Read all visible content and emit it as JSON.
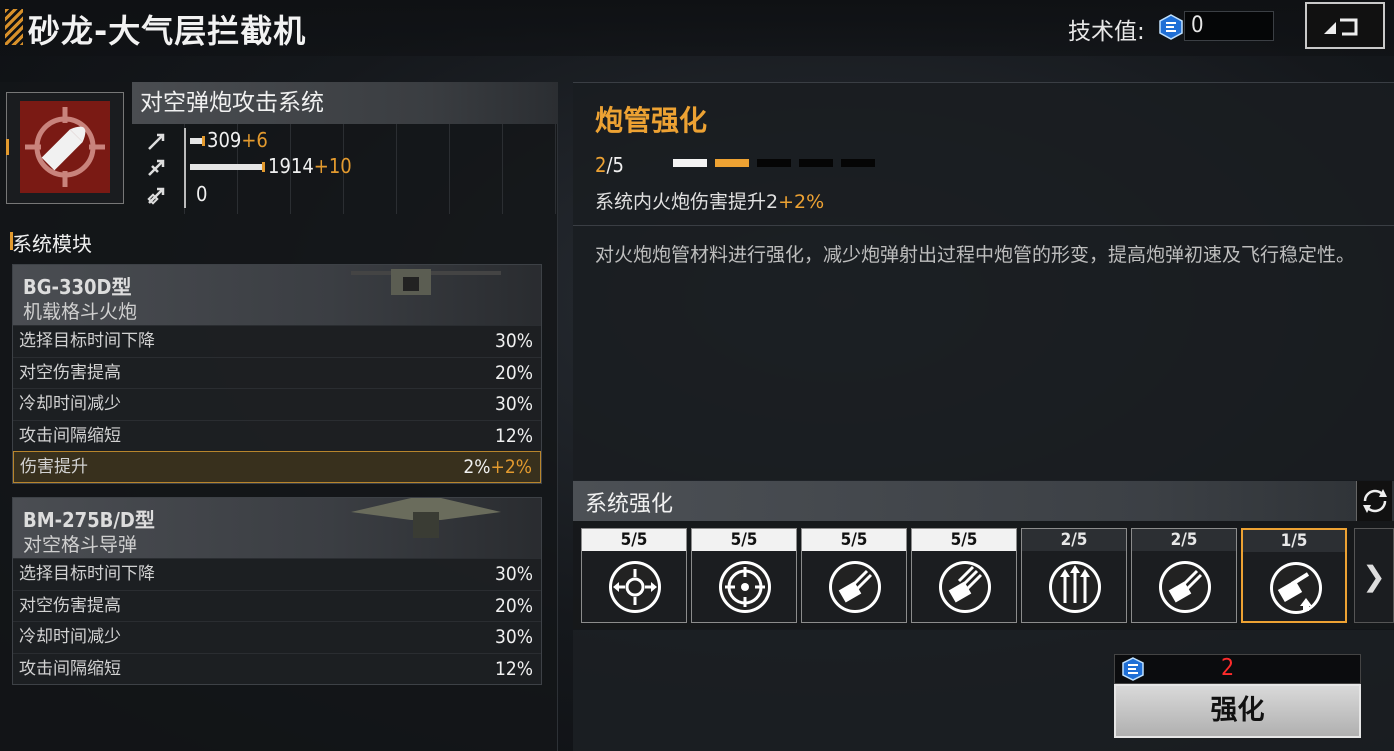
{
  "header": {
    "title": "砂龙-大气层拦截机",
    "tech_label": "技术值:",
    "tech_value": "0"
  },
  "system": {
    "name": "对空弹炮攻击系统",
    "stats": [
      {
        "icon": "attack-stat-icon",
        "value": "309",
        "bonus": "+6"
      },
      {
        "icon": "range-stat-icon",
        "value": "1914",
        "bonus": "+10"
      },
      {
        "icon": "defense-stat-icon",
        "value": "0",
        "bonus": ""
      }
    ]
  },
  "modules_label": "系统模块",
  "modules": [
    {
      "code": "BG-330D型",
      "name": "机载格斗火炮",
      "rows": [
        {
          "label": "选择目标时间下降",
          "value": "30%",
          "bonus": ""
        },
        {
          "label": "对空伤害提高",
          "value": "20%",
          "bonus": ""
        },
        {
          "label": "冷却时间减少",
          "value": "30%",
          "bonus": ""
        },
        {
          "label": "攻击间隔缩短",
          "value": "12%",
          "bonus": ""
        },
        {
          "label": "伤害提升",
          "value": "2%",
          "bonus": "+2%"
        }
      ]
    },
    {
      "code": "BM-275B/D型",
      "name": "对空格斗导弹",
      "rows": [
        {
          "label": "选择目标时间下降",
          "value": "30%",
          "bonus": ""
        },
        {
          "label": "对空伤害提高",
          "value": "20%",
          "bonus": ""
        },
        {
          "label": "冷却时间减少",
          "value": "30%",
          "bonus": ""
        },
        {
          "label": "攻击间隔缩短",
          "value": "12%",
          "bonus": ""
        }
      ]
    }
  ],
  "upgrade": {
    "title": "炮管强化",
    "level_current": "2",
    "level_max": "/5",
    "level_fraction": 0.4,
    "effect_text": "系统内火炮伤害提升2",
    "effect_bonus": "+2%",
    "description": "对火炮炮管材料进行强化，减少炮弹射出过程中炮管的形变，提高炮弹初速及飞行稳定性。"
  },
  "enhance": {
    "title": "系统强化",
    "slots": [
      {
        "level": "5/5",
        "icon": "crosshair-arrows-icon"
      },
      {
        "level": "5/5",
        "icon": "target-reticle-icon"
      },
      {
        "level": "5/5",
        "icon": "missile-turret-icon"
      },
      {
        "level": "5/5",
        "icon": "missile-turret-alt-icon"
      },
      {
        "level": "2/5",
        "icon": "triple-arrows-icon"
      },
      {
        "level": "2/5",
        "icon": "missile-turret-plus-icon"
      },
      {
        "level": "1/5",
        "icon": "cannon-upgrade-icon"
      }
    ],
    "cost": "2",
    "button_label": "强化"
  },
  "colors": {
    "accent": "#eda233",
    "cost": "#ff2b2b",
    "system_icon_bg": "#7a1a14"
  }
}
